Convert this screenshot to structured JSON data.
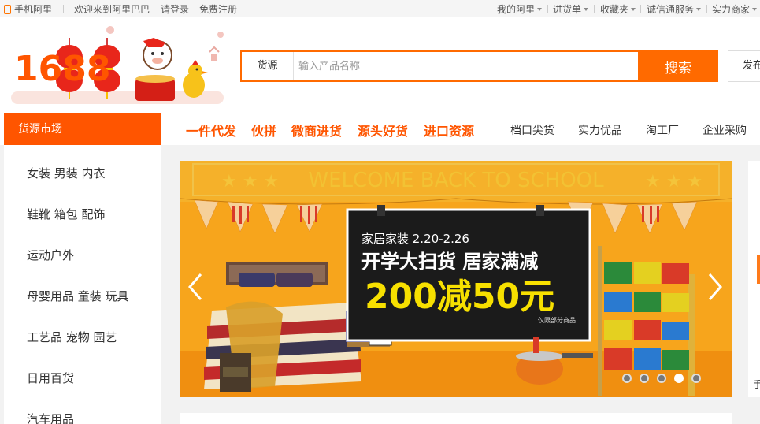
{
  "topbar": {
    "mobile": "手机阿里",
    "welcome": "欢迎来到阿里巴巴",
    "login": "请登录",
    "register": "免费注册",
    "my_ali": "我的阿里",
    "purchase": "进货单",
    "favorites": "收藏夹",
    "trust": "诚信通服务",
    "merchant": "实力商家"
  },
  "logo": {
    "text": "1688"
  },
  "search": {
    "type": "货源",
    "placeholder": "输入产品名称",
    "button": "搜索"
  },
  "publish": "发布",
  "nav": {
    "category_title": "货源市场",
    "hot": [
      "一件代发",
      "伙拼",
      "微商进货",
      "源头好货",
      "进口资源"
    ],
    "normal": [
      "档口尖货",
      "实力优品",
      "淘工厂",
      "企业采购"
    ]
  },
  "categories": [
    "女装 男装 内衣",
    "鞋靴 箱包 配饰",
    "运动户外",
    "母婴用品 童装 玩具",
    "工艺品 宠物 园艺",
    "日用百货",
    "汽车用品"
  ],
  "banner": {
    "headline": "WELCOME BACK TO SCHOOL",
    "subtitle": "家居家装 2.20-2.26",
    "main": "开学大扫货 居家满减",
    "offer": "200减50元",
    "note": "仅限部分商品",
    "slides": 5,
    "active_slide": 4
  },
  "right_panel": {
    "text": "手"
  },
  "colors": {
    "accent": "#ff6a00",
    "banner_bg": "#f7a51c"
  }
}
